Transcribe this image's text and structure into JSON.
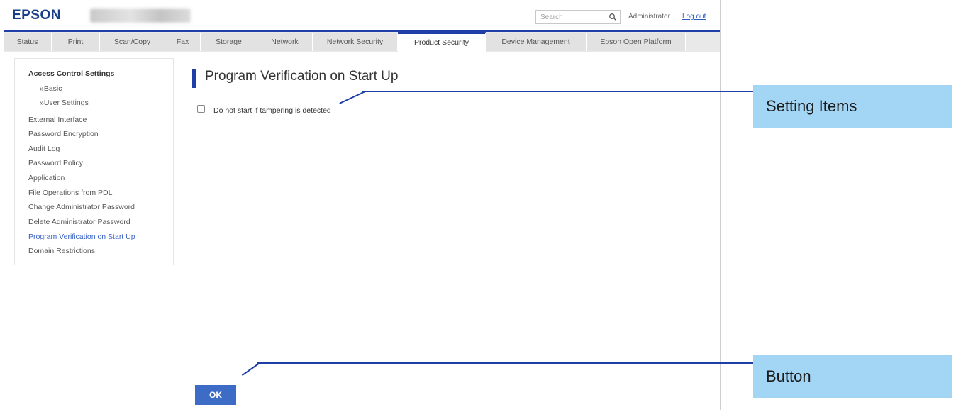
{
  "header": {
    "logo": "EPSON",
    "search_placeholder": "Search",
    "user_label": "Administrator",
    "logout_label": "Log out"
  },
  "tabs": [
    {
      "label": "Status"
    },
    {
      "label": "Print"
    },
    {
      "label": "Scan/Copy"
    },
    {
      "label": "Fax"
    },
    {
      "label": "Storage"
    },
    {
      "label": "Network"
    },
    {
      "label": "Network Security"
    },
    {
      "label": "Product Security",
      "active": true
    },
    {
      "label": "Device Management"
    },
    {
      "label": "Epson Open Platform"
    }
  ],
  "sidebar": {
    "items": [
      {
        "label": "Access Control Settings"
      },
      {
        "label": "»Basic"
      },
      {
        "label": "»User Settings"
      },
      {
        "label": "External Interface"
      },
      {
        "label": "Password Encryption"
      },
      {
        "label": "Audit Log"
      },
      {
        "label": "Password Policy"
      },
      {
        "label": "Application"
      },
      {
        "label": "File Operations from PDL"
      },
      {
        "label": "Change Administrator Password"
      },
      {
        "label": "Delete Administrator Password"
      },
      {
        "label": "Program Verification on Start Up",
        "current": true
      },
      {
        "label": "Domain Restrictions"
      }
    ]
  },
  "main": {
    "title": "Program Verification on Start Up",
    "checkbox_label": "Do not start if tampering is detected",
    "checkbox_checked": false,
    "ok_label": "OK"
  },
  "callouts": {
    "setting_items": "Setting Items",
    "button": "Button"
  },
  "colors": {
    "accent": "#1f3fa8",
    "button": "#3c6cc6",
    "callout_bg": "#a3d5f5",
    "link": "#2b5bc4"
  }
}
